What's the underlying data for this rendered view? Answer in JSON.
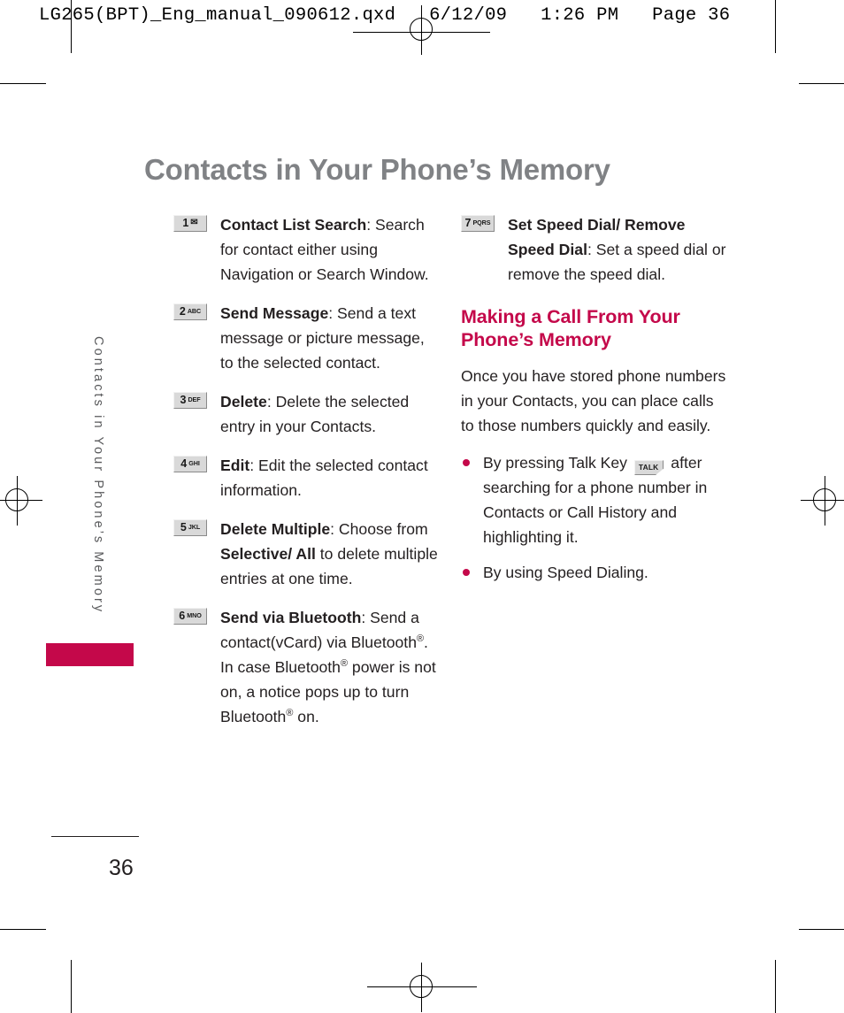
{
  "prepress": {
    "slug": "LG265(BPT)_Eng_manual_090612.qxd   6/12/09   1:26 PM   Page 36"
  },
  "colors": {
    "accent_pink": "#C4084A",
    "title_gray": "#808285",
    "side_tab_gray": "#58595b",
    "body": "#231f20",
    "keycap_face": "#d9d9d9"
  },
  "side_tab": {
    "label": "Contacts in Your Phone’s Memory"
  },
  "page_title": "Contacts in Your Phone’s Memory",
  "left_column": {
    "items": [
      {
        "keycap": {
          "number": "1",
          "sub": "",
          "glyph": "✉",
          "icon_name": "envelope-icon"
        },
        "term": "Contact List Search",
        "separator": ":",
        "description": " Search for contact either using Navigation or Search Window."
      },
      {
        "keycap": {
          "number": "2",
          "sub": "ABC",
          "glyph": "",
          "icon_name": "key-2-abc"
        },
        "term": "Send Message",
        "separator": ":",
        "description": " Send a text message or picture message, to the selected contact."
      },
      {
        "keycap": {
          "number": "3",
          "sub": "DEF",
          "glyph": "",
          "icon_name": "key-3-def"
        },
        "term": "Delete",
        "separator": ":",
        "description": " Delete the selected entry in your Contacts."
      },
      {
        "keycap": {
          "number": "4",
          "sub": "GHI",
          "glyph": "",
          "icon_name": "key-4-ghi"
        },
        "term": "Edit",
        "separator": ":",
        "description": " Edit the selected contact information."
      },
      {
        "keycap": {
          "number": "5",
          "sub": "JKL",
          "glyph": "",
          "icon_name": "key-5-jkl"
        },
        "term": "Delete Multiple",
        "separator": ":",
        "description_before": " Choose from ",
        "bold_inline": "Selective/ All",
        "description_after": " to delete multiple entries at one time."
      },
      {
        "keycap": {
          "number": "6",
          "sub": "MNO",
          "glyph": "",
          "icon_name": "key-6-mno"
        },
        "term": "Send via Bluetooth",
        "separator": ":",
        "description": " Send a contact(vCard) via Bluetooth®. In case Bluetooth® power is not on, a notice pops up to turn Bluetooth® on."
      }
    ]
  },
  "right_column": {
    "items": [
      {
        "keycap": {
          "number": "7",
          "sub": "PQRS",
          "glyph": "",
          "icon_name": "key-7-pqrs"
        },
        "term": "Set Speed Dial/ Remove Speed Dial",
        "separator": ":",
        "description": " Set a speed dial or remove the speed dial."
      }
    ],
    "section_heading": "Making a Call From Your Phone’s Memory",
    "intro_paragraph": "Once you have stored phone numbers in your Contacts, you can place calls to those numbers quickly and easily.",
    "bullets": [
      {
        "text_before": "By pressing Talk Key ",
        "key_icon_label": "TALK",
        "text_after": " after searching for a phone number in Contacts or Call History and highlighting it."
      },
      {
        "text_before": "By using Speed Dialing.",
        "key_icon_label": "",
        "text_after": ""
      }
    ]
  },
  "footer": {
    "page_number": "36"
  }
}
